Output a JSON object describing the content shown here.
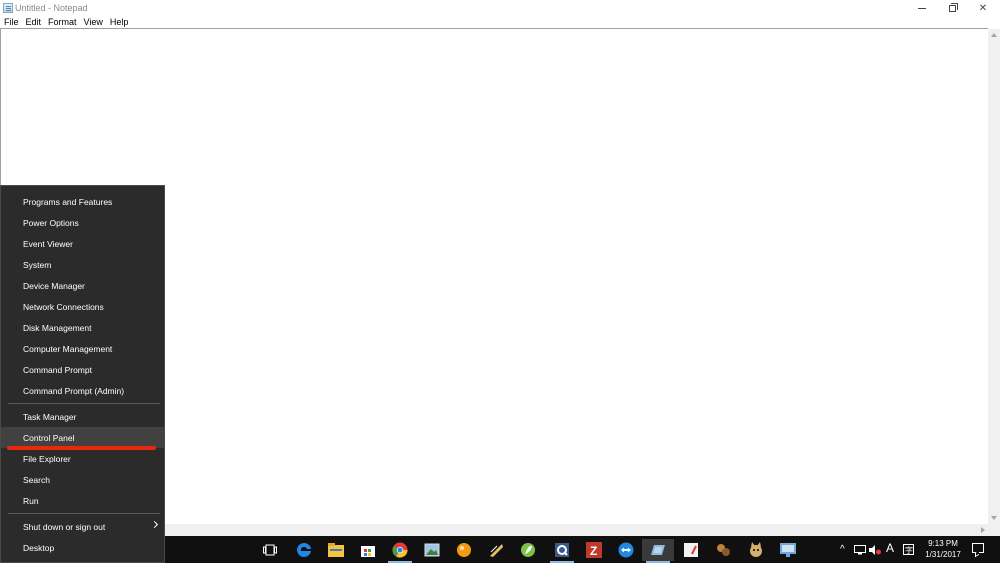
{
  "window": {
    "title": "Untitled - Notepad",
    "menu": [
      "File",
      "Edit",
      "Format",
      "View",
      "Help"
    ]
  },
  "winx_menu": {
    "items": [
      "Programs and Features",
      "Power Options",
      "Event Viewer",
      "System",
      "Device Manager",
      "Network Connections",
      "Disk Management",
      "Computer Management",
      "Command Prompt",
      "Command Prompt (Admin)",
      "Task Manager",
      "Control Panel",
      "File Explorer",
      "Search",
      "Run",
      "Shut down or sign out",
      "Desktop"
    ],
    "highlighted": "Control Panel",
    "highlight_color": "#e8270c"
  },
  "taskbar": {
    "pinned": [
      {
        "icon": "task-view-icon",
        "color": "#ffffff"
      },
      {
        "icon": "edge-icon",
        "color": "#1e88e5"
      },
      {
        "icon": "file-explorer-icon",
        "color": "#f5c542"
      },
      {
        "icon": "store-icon",
        "color": "#ffffff"
      },
      {
        "icon": "chrome-icon",
        "color": "#e53935"
      },
      {
        "icon": "photo-viewer-icon",
        "color": "#9fc5e8"
      },
      {
        "icon": "orange-ball-icon",
        "color": "#f39c12"
      },
      {
        "icon": "tools-icon",
        "color": "#e0c060"
      },
      {
        "icon": "green-leaf-icon",
        "color": "#7cc242"
      },
      {
        "icon": "blue-q-icon",
        "color": "#b0c4de"
      },
      {
        "icon": "filezilla-icon",
        "color": "#c0392b"
      },
      {
        "icon": "teamviewer-icon",
        "color": "#1e88e5"
      },
      {
        "icon": "notepad-icon",
        "color": "#8fb9e2"
      },
      {
        "icon": "paint-icon",
        "color": "#e8e8e8"
      },
      {
        "icon": "game-icon",
        "color": "#c08040"
      },
      {
        "icon": "cat-icon",
        "color": "#d4b070"
      },
      {
        "icon": "remote-desktop-icon",
        "color": "#6fa8dc"
      }
    ],
    "tray": {
      "chevron": "^",
      "ime": "A",
      "time": "9:13 PM",
      "date": "1/31/2017"
    }
  }
}
